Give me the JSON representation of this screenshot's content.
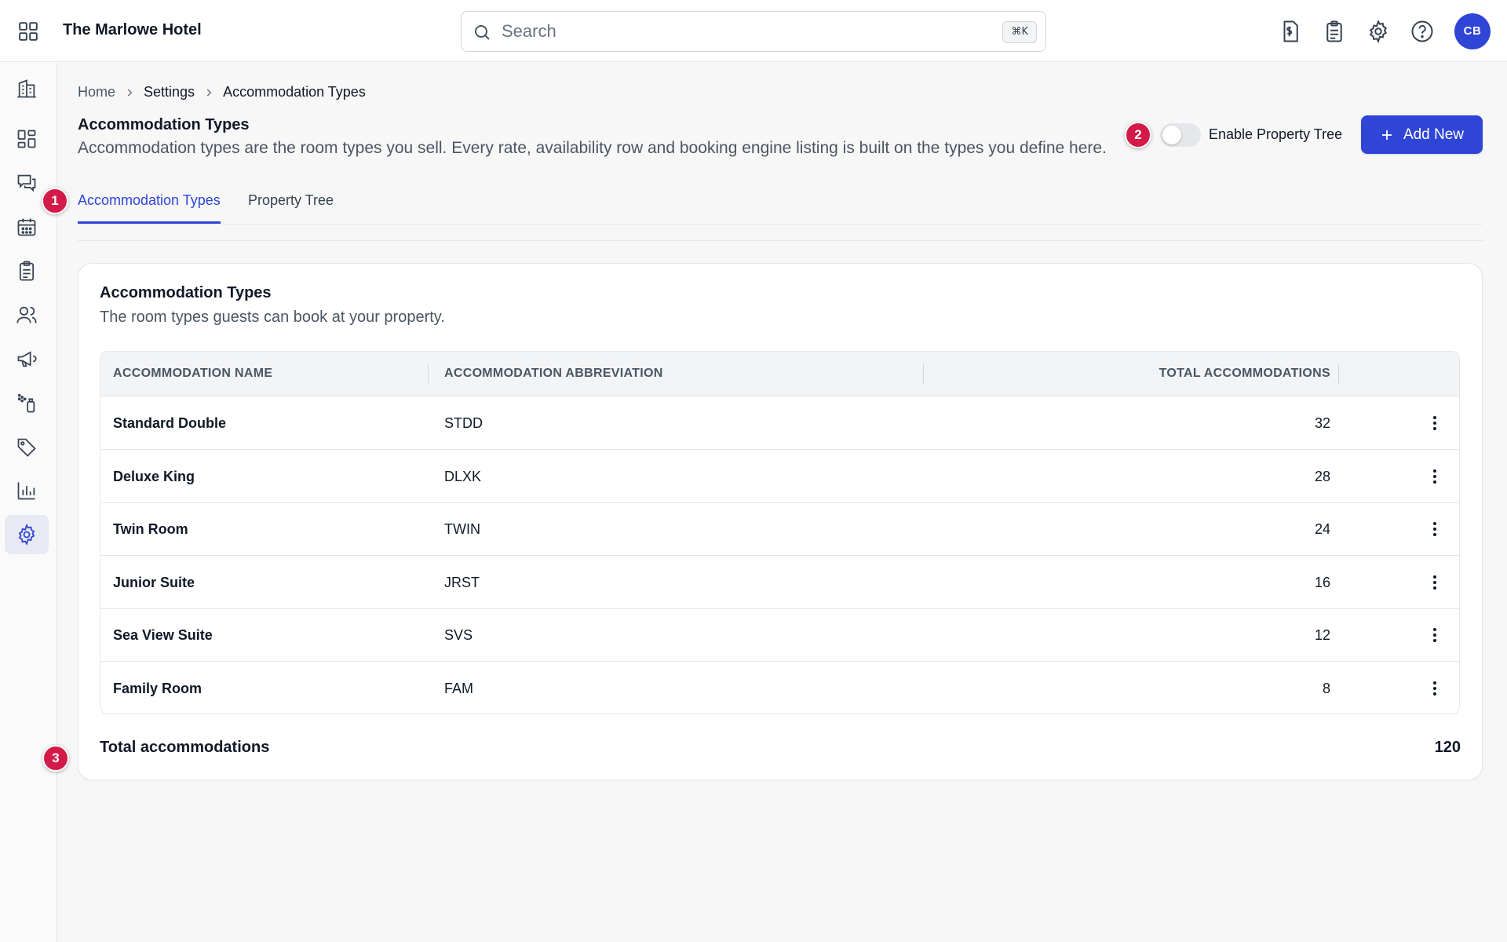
{
  "header": {
    "title": "The Marlowe Hotel",
    "search_placeholder": "Search",
    "search_shortcut": "⌘K",
    "icons": [
      "billing-icon",
      "clipboard-icon",
      "gear-icon",
      "help-icon"
    ],
    "avatar_initials": "CB",
    "accent_color": "#2f45d6"
  },
  "sidebar": {
    "items": [
      {
        "icon": "building-icon",
        "active": false
      },
      {
        "icon": "dashboard-icon",
        "active": false
      },
      {
        "icon": "messages-icon",
        "active": false
      },
      {
        "icon": "calendar-icon",
        "active": false
      },
      {
        "icon": "clipboard-icon",
        "active": false
      },
      {
        "icon": "users-icon",
        "active": false
      },
      {
        "icon": "megaphone-icon",
        "active": false
      },
      {
        "icon": "housekeeping-icon",
        "active": false
      },
      {
        "icon": "tag-icon",
        "active": false
      },
      {
        "icon": "bar-chart-icon",
        "active": false
      },
      {
        "icon": "gear-icon",
        "active": true
      }
    ]
  },
  "breadcrumb": [
    "Home",
    "Settings",
    "Accommodation Types"
  ],
  "page": {
    "title": "Accommodation Types",
    "description": "Accommodation types are the room types you sell. Every rate, availability row and booking engine listing is built on the types you define here.",
    "toggle_label": "Enable Property Tree",
    "toggle_on": false,
    "add_button": "Add New"
  },
  "tabs": [
    {
      "label": "Accommodation Types",
      "active": true
    },
    {
      "label": "Property Tree",
      "active": false
    }
  ],
  "card": {
    "title": "Accommodation Types",
    "description": "The room types guests can book at your property."
  },
  "table": {
    "columns": [
      "ACCOMMODATION NAME",
      "ACCOMMODATION ABBREVIATION",
      "TOTAL ACCOMMODATIONS"
    ],
    "rows": [
      {
        "name": "Standard Double",
        "abbr": "STDD",
        "total": "32"
      },
      {
        "name": "Deluxe King",
        "abbr": "DLXK",
        "total": "28"
      },
      {
        "name": "Twin Room",
        "abbr": "TWIN",
        "total": "24"
      },
      {
        "name": "Junior Suite",
        "abbr": "JRST",
        "total": "16"
      },
      {
        "name": "Sea View Suite",
        "abbr": "SVS",
        "total": "12"
      },
      {
        "name": "Family Room",
        "abbr": "FAM",
        "total": "8"
      }
    ]
  },
  "summary": {
    "label": "Total accommodations",
    "value": "120"
  },
  "markers": [
    "1",
    "2",
    "3"
  ]
}
